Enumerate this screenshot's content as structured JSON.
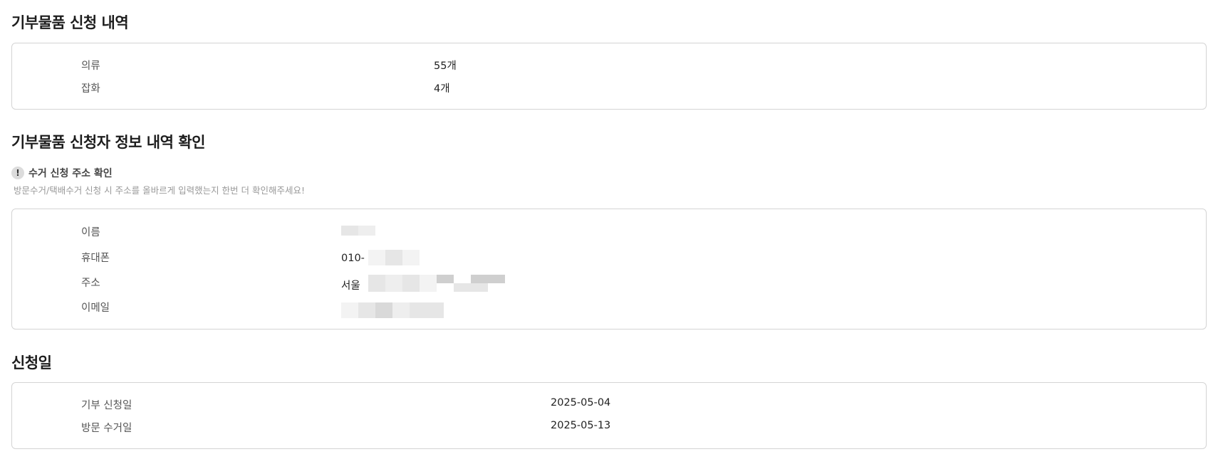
{
  "donation_items": {
    "title": "기부물품 신청 내역",
    "rows": [
      {
        "label": "의류",
        "value": "55개"
      },
      {
        "label": "잡화",
        "value": "4개"
      }
    ]
  },
  "applicant": {
    "title": "기부물품 신청자 정보 내역 확인",
    "notice_icon": "!",
    "notice_title": "수거 신청 주소 확인",
    "notice_desc": "방문수거/택배수거 신청 시 주소를 올바르게 입력했는지 한번 더 확인해주세요!",
    "rows": [
      {
        "label": "이름",
        "value": ""
      },
      {
        "label": "휴대폰",
        "value": "010-"
      },
      {
        "label": "주소",
        "value": "서울"
      },
      {
        "label": "이메일",
        "value": ""
      }
    ]
  },
  "dates": {
    "title": "신청일",
    "rows": [
      {
        "label": "기부 신청일",
        "value": "2025-05-04"
      },
      {
        "label": "방문 수거일",
        "value": "2025-05-13"
      }
    ]
  }
}
